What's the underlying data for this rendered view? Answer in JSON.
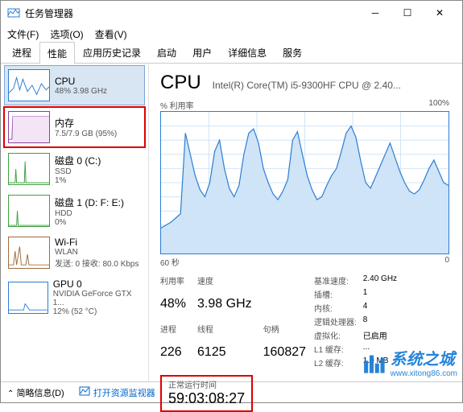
{
  "window": {
    "title": "任务管理器"
  },
  "menu": {
    "file": "文件(F)",
    "options": "选项(O)",
    "view": "查看(V)"
  },
  "tabs": [
    "进程",
    "性能",
    "应用历史记录",
    "启动",
    "用户",
    "详细信息",
    "服务"
  ],
  "active_tab": 1,
  "sidebar": {
    "items": [
      {
        "name": "CPU",
        "detail": "48% 3.98 GHz"
      },
      {
        "name": "内存",
        "detail": "7.5/7.9 GB (95%)"
      },
      {
        "name": "磁盘 0 (C:)",
        "detail1": "SSD",
        "detail2": "1%"
      },
      {
        "name": "磁盘 1 (D: F: E:)",
        "detail1": "HDD",
        "detail2": "0%"
      },
      {
        "name": "Wi-Fi",
        "detail1": "WLAN",
        "detail2": "发送: 0 接收: 80.0 Kbps"
      },
      {
        "name": "GPU 0",
        "detail1": "NVIDIA GeForce GTX 1...",
        "detail2": "12% (52 °C)"
      }
    ]
  },
  "main": {
    "title": "CPU",
    "subtitle": "Intel(R) Core(TM) i5-9300HF CPU @ 2.40...",
    "graph_top_left": "% 利用率",
    "graph_top_right": "100%",
    "graph_bottom_left": "60 秒",
    "graph_bottom_right": "0",
    "row_labels": {
      "util": "利用率",
      "speed": "速度",
      "procs": "进程",
      "threads": "线程",
      "handles": "句柄"
    },
    "util": "48%",
    "speed": "3.98 GHz",
    "procs": "226",
    "threads": "6125",
    "handles": "160827",
    "uptime_label": "正常运行时间",
    "uptime": "59:03:08:27",
    "info_labels": {
      "base": "基准速度:",
      "sockets": "插槽:",
      "cores": "内核:",
      "logical": "逻辑处理器:",
      "virt": "虚拟化:",
      "l1": "L1 缓存:",
      "l2": "L2 缓存:"
    },
    "info": {
      "base": "2.40 GHz",
      "sockets": "1",
      "cores": "4",
      "logical": "8",
      "virt": "已启用",
      "l1": "...",
      "l2": "1.0 MB"
    }
  },
  "status": {
    "brief": "简略信息(D)",
    "open_resmon": "打开资源监视器"
  },
  "watermark": {
    "text": "系统之城",
    "url": "www.xitong86.com"
  },
  "chart_data": {
    "type": "line",
    "title": "CPU % 利用率",
    "ylim": [
      0,
      100
    ],
    "x_seconds": 60,
    "values": [
      18,
      20,
      22,
      25,
      28,
      85,
      70,
      55,
      45,
      40,
      50,
      72,
      80,
      60,
      46,
      40,
      48,
      70,
      85,
      88,
      78,
      60,
      50,
      42,
      38,
      44,
      52,
      80,
      86,
      70,
      55,
      45,
      38,
      40,
      48,
      55,
      60,
      72,
      85,
      90,
      82,
      65,
      50,
      46,
      54,
      62,
      70,
      78,
      68,
      58,
      50,
      44,
      42,
      45,
      52,
      60,
      66,
      58,
      50,
      48
    ]
  }
}
